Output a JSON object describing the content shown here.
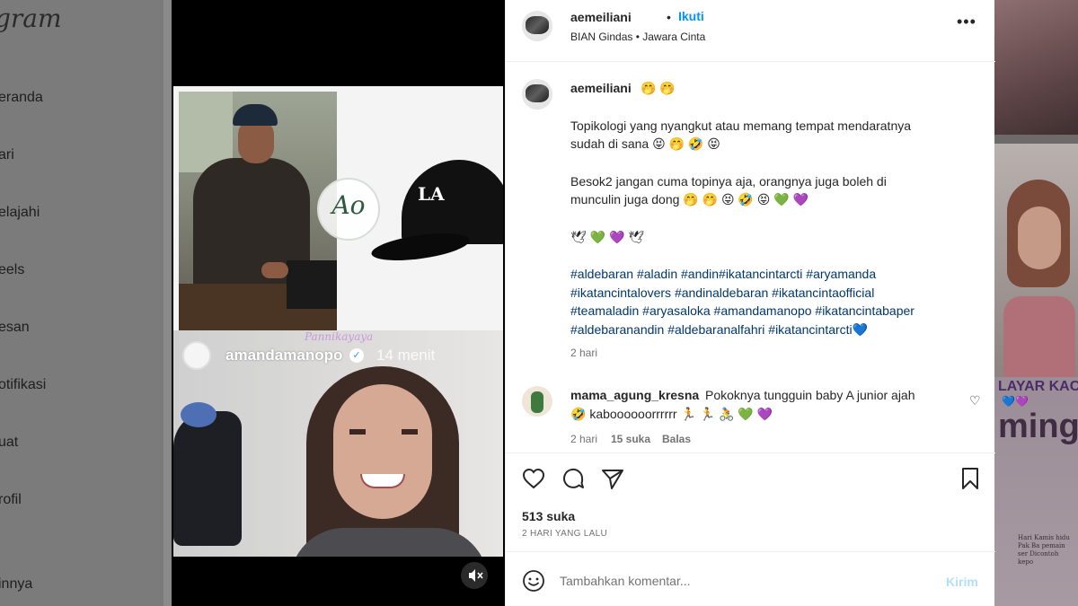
{
  "app": {
    "brand_fragment": "gram",
    "nav_items": [
      "eranda",
      "ari",
      "elajahi",
      "eels",
      "esan",
      "otifikasi",
      "uat",
      "rofil",
      "innya"
    ]
  },
  "story": {
    "username": "amandamanopo",
    "time": "14 menit",
    "watermark": "Pannikayaya",
    "logo_letters": "Ao",
    "cap_logo": "LA"
  },
  "post": {
    "author": "aemeiliani",
    "follow_label": "Ikuti",
    "audio": "BIAN Gindas • Jawara Cinta",
    "caption": {
      "emojis": "🤭 🤭",
      "line1": "Topikologi yang nyangkut atau memang tempat mendaratnya",
      "line2": "sudah di sana 😝 🤭 🤣 😝",
      "line3": "Besok2 jangan cuma topinya aja, orangnya juga boleh di",
      "line4": "munculin juga dong 🤭 🤭 😝 🤣 😝 💚 💜",
      "line5": "🕊 💚 💜 🕊",
      "hashtags1": "#aldebaran #aladin #andin#ikatancintarcti #aryamanda",
      "hashtags2": "#ikatancintalovers #andinaldebaran #ikatancintaofficial",
      "hashtags3": "#teamaladin #aryasaloka #amandamanopo #ikatancintabaper",
      "hashtags4": "#aldebaranandin #aldebaranalfahri #ikatancintarcti💙",
      "time": "2 hari"
    },
    "comment": {
      "username": "mama_agung_kresna",
      "text1": "Pokoknya tungguin baby A junior ajah",
      "text2": "🤣 kaboooooorrrrrr 🏃 🏃 🚴 💚 💜",
      "time": "2 hari",
      "likes": "15 suka",
      "reply": "Balas"
    },
    "likes": "513 suka",
    "date": "2 HARI YANG LALU",
    "composer": {
      "placeholder": "Tambahkan komentar...",
      "post_label": "Kirim"
    }
  },
  "backdrop": {
    "layar": "LAYAR KACA",
    "hearts": "💙💜",
    "ming": "ming",
    "small_text": "Hari Kamis hidu Pak Ba pemain ser Dicontoh kepo"
  },
  "colors": {
    "accent_blue": "#0095f6",
    "hashtag": "#00376b",
    "muted": "#737373"
  }
}
